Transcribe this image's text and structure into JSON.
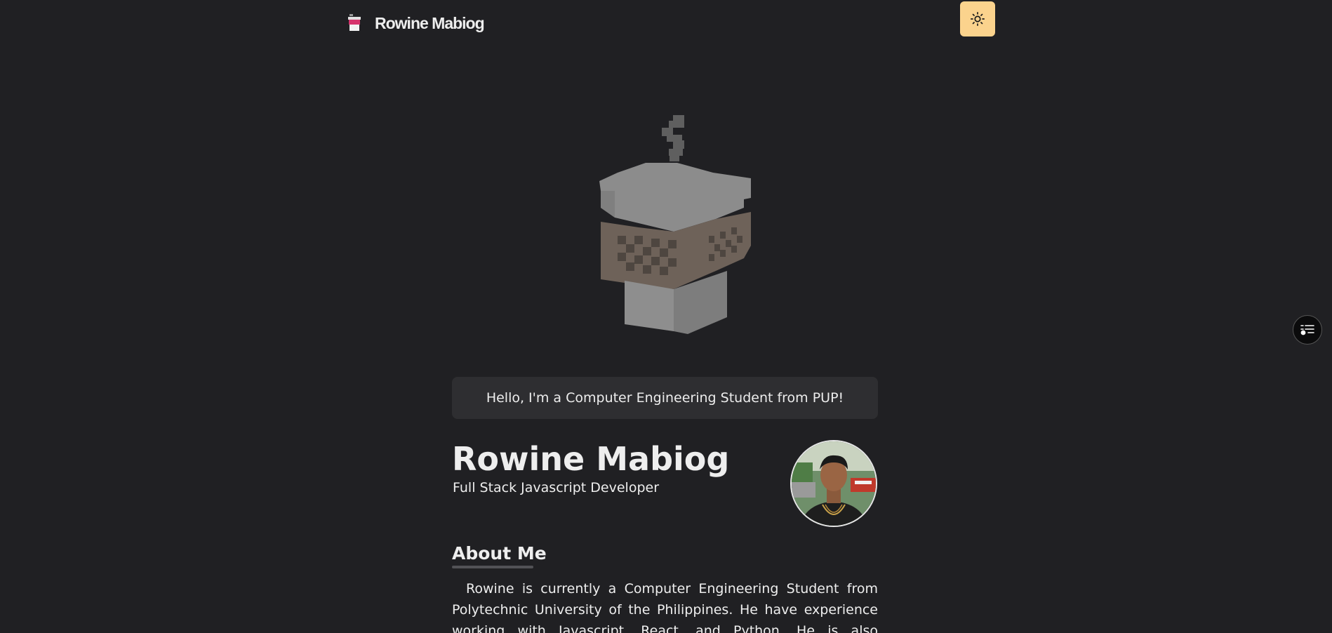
{
  "header": {
    "brand_name": "Rowine Mabiog",
    "brand_icon": "coffee-cup-icon",
    "theme_toggle_icon": "sun-icon"
  },
  "hero": {
    "model_icon": "voxel-coffee-cup"
  },
  "greeting": {
    "text": "Hello, I'm a Computer Engineering Student from PUP!"
  },
  "profile": {
    "name": "Rowine Mabiog",
    "role": "Full Stack Javascript Developer"
  },
  "about": {
    "title": "About Me",
    "text": "Rowine is currently a Computer Engineering Student from Polytechnic University of the Philippines. He have experience working with Javascript, React, and Python. He is also interested in"
  },
  "side_button": {
    "icon": "menu-list-icon"
  },
  "colors": {
    "background": "#202023",
    "accent_toggle": "#fbd38d",
    "card": "#2e2e31",
    "text": "#eeeeee"
  }
}
